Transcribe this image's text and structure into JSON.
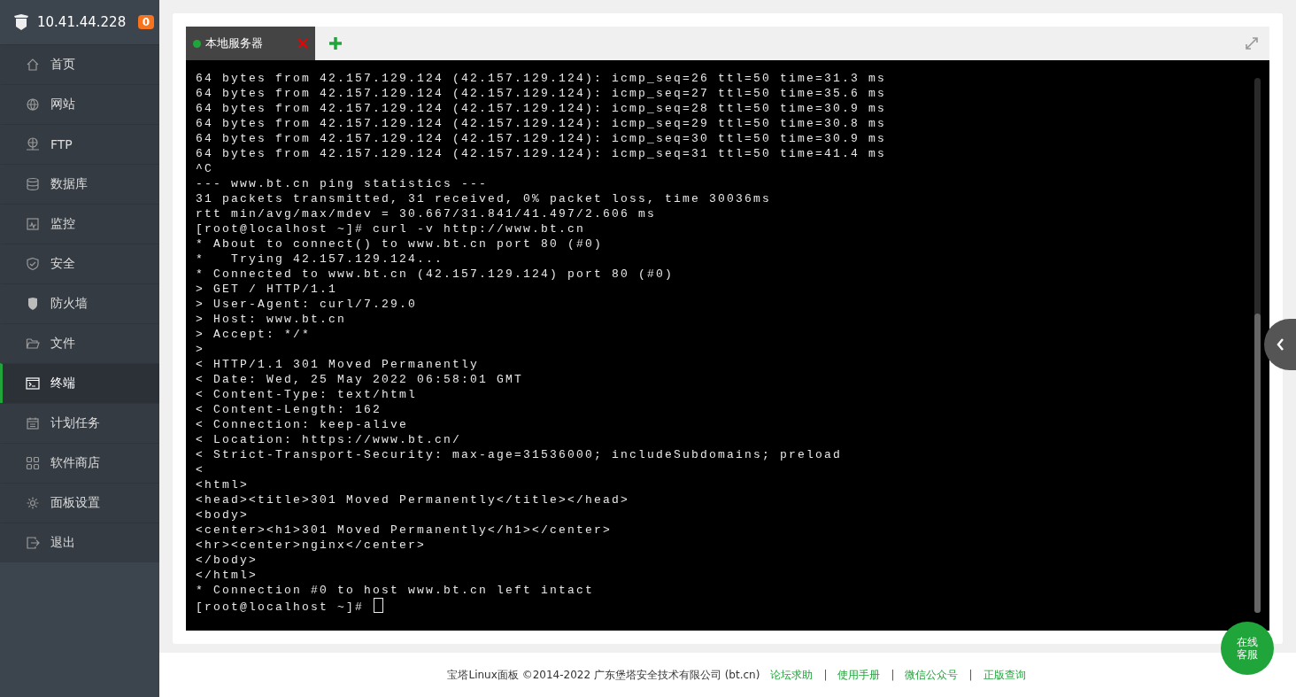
{
  "sidebar": {
    "host": "10.41.44.228",
    "badge": "0",
    "items": [
      {
        "label": "首页",
        "kind": "home",
        "selected": false
      },
      {
        "label": "网站",
        "kind": "globe",
        "selected": false
      },
      {
        "label": "FTP",
        "kind": "ftp",
        "selected": false
      },
      {
        "label": "数据库",
        "kind": "database",
        "selected": false
      },
      {
        "label": "监控",
        "kind": "monitor",
        "selected": false
      },
      {
        "label": "安全",
        "kind": "shield",
        "selected": false
      },
      {
        "label": "防火墙",
        "kind": "firewall",
        "selected": false
      },
      {
        "label": "文件",
        "kind": "folder",
        "selected": false
      },
      {
        "label": "终端",
        "kind": "terminal",
        "selected": true
      },
      {
        "label": "计划任务",
        "kind": "calendar",
        "selected": false
      },
      {
        "label": "软件商店",
        "kind": "apps",
        "selected": false
      },
      {
        "label": "面板设置",
        "kind": "gear",
        "selected": false
      },
      {
        "label": "退出",
        "kind": "logout",
        "selected": false
      }
    ]
  },
  "tabs": [
    {
      "label": "本地服务器",
      "color": "#20a53a",
      "selected": true
    }
  ],
  "terminal": {
    "cursor": true,
    "lines": [
      "64 bytes from 42.157.129.124 (42.157.129.124): icmp_seq=26 ttl=50 time=31.3 ms",
      "64 bytes from 42.157.129.124 (42.157.129.124): icmp_seq=27 ttl=50 time=35.6 ms",
      "64 bytes from 42.157.129.124 (42.157.129.124): icmp_seq=28 ttl=50 time=30.9 ms",
      "64 bytes from 42.157.129.124 (42.157.129.124): icmp_seq=29 ttl=50 time=30.8 ms",
      "64 bytes from 42.157.129.124 (42.157.129.124): icmp_seq=30 ttl=50 time=30.9 ms",
      "64 bytes from 42.157.129.124 (42.157.129.124): icmp_seq=31 ttl=50 time=41.4 ms",
      "^C",
      "--- www.bt.cn ping statistics ---",
      "31 packets transmitted, 31 received, 0% packet loss, time 30036ms",
      "rtt min/avg/max/mdev = 30.667/31.841/41.497/2.606 ms",
      "[root@localhost ~]# curl -v http://www.bt.cn",
      "* About to connect() to www.bt.cn port 80 (#0)",
      "*   Trying 42.157.129.124...",
      "* Connected to www.bt.cn (42.157.129.124) port 80 (#0)",
      "> GET / HTTP/1.1",
      "> User-Agent: curl/7.29.0",
      "> Host: www.bt.cn",
      "> Accept: */*",
      ">",
      "< HTTP/1.1 301 Moved Permanently",
      "< Date: Wed, 25 May 2022 06:58:01 GMT",
      "< Content-Type: text/html",
      "< Content-Length: 162",
      "< Connection: keep-alive",
      "< Location: https://www.bt.cn/",
      "< Strict-Transport-Security: max-age=31536000; includeSubdomains; preload",
      "<",
      "<html>",
      "<head><title>301 Moved Permanently</title></head>",
      "<body>",
      "<center><h1>301 Moved Permanently</h1></center>",
      "<hr><center>nginx</center>",
      "</body>",
      "</html>",
      "* Connection #0 to host www.bt.cn left intact",
      "[root@localhost ~]# "
    ]
  },
  "service_button": "在线客服",
  "footer": {
    "text": "宝塔Linux面板 ©2014-2022 广东堡塔安全技术有限公司 (bt.cn)",
    "links": [
      "论坛求助",
      "使用手册",
      "微信公众号",
      "正版查询"
    ],
    "separator": "|"
  }
}
